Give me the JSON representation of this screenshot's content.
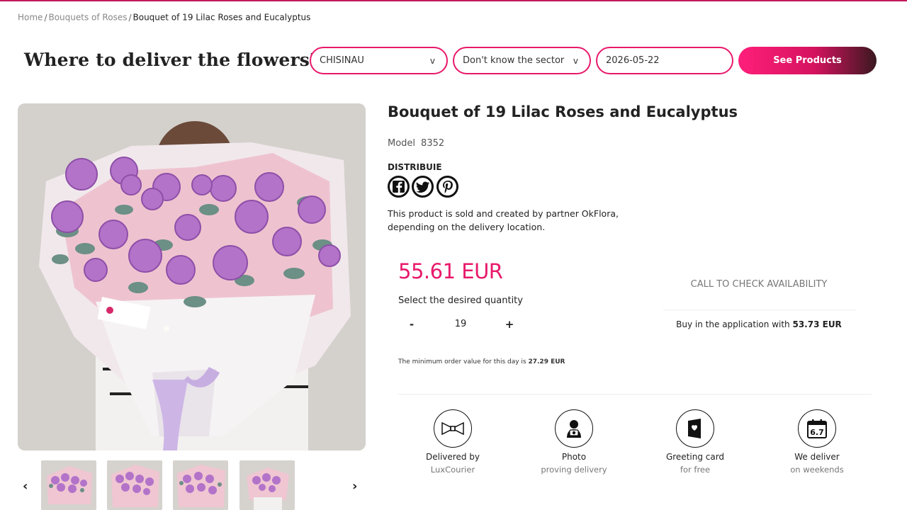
{
  "breadcrumb": {
    "home": "Home",
    "category": "Bouquets of Roses",
    "current": "Bouquet of 19 Lilac Roses and Eucalyptus",
    "separator": "/"
  },
  "delivery": {
    "title": "Where to deliver the flowers?",
    "city": "CHISINAU",
    "sector": "Don't know the sector",
    "date": "2026-05-22",
    "chevron": "v",
    "submit_label": "See Products"
  },
  "gallery": {
    "prev_icon": "chevron-left-icon",
    "next_icon": "chevron-right-icon",
    "prev_glyph": "‹",
    "next_glyph": "›"
  },
  "product": {
    "title": "Bouquet of 19 Lilac Roses and Eucalyptus",
    "model_label": "Model",
    "model_value": "8352",
    "share_label": "DISTRIBUIE",
    "partner_text": "This product is sold and created by partner OkFlora, depending on the delivery location.",
    "price": "55.61 EUR",
    "qty_label": "Select the desired quantity",
    "qty_minus": "-",
    "qty_value": "19",
    "qty_plus": "+",
    "min_order_text": "The minimum order value for this day is",
    "min_order_value": "27.29 EUR",
    "call_check": "CALL TO CHECK AVAILABILITY",
    "app_text": "Buy in the application with",
    "app_price": "53.73 EUR"
  },
  "features": [
    {
      "icon": "ribbon-icon",
      "line1": "Delivered by",
      "line2": "LuxCourier"
    },
    {
      "icon": "camera-person-icon",
      "line1": "Photo",
      "line2": "proving delivery"
    },
    {
      "icon": "greeting-card-icon",
      "line1": "Greeting card",
      "line2": "for free"
    },
    {
      "icon": "calendar-icon",
      "line1": "We deliver",
      "line2": "on weekends"
    }
  ],
  "calendar_icon_text": "6.7",
  "colors": {
    "accent": "#e8196b",
    "button_gradient_start": "#ff1f7a",
    "button_gradient_end": "#3a1820",
    "muted_text": "#777777"
  }
}
